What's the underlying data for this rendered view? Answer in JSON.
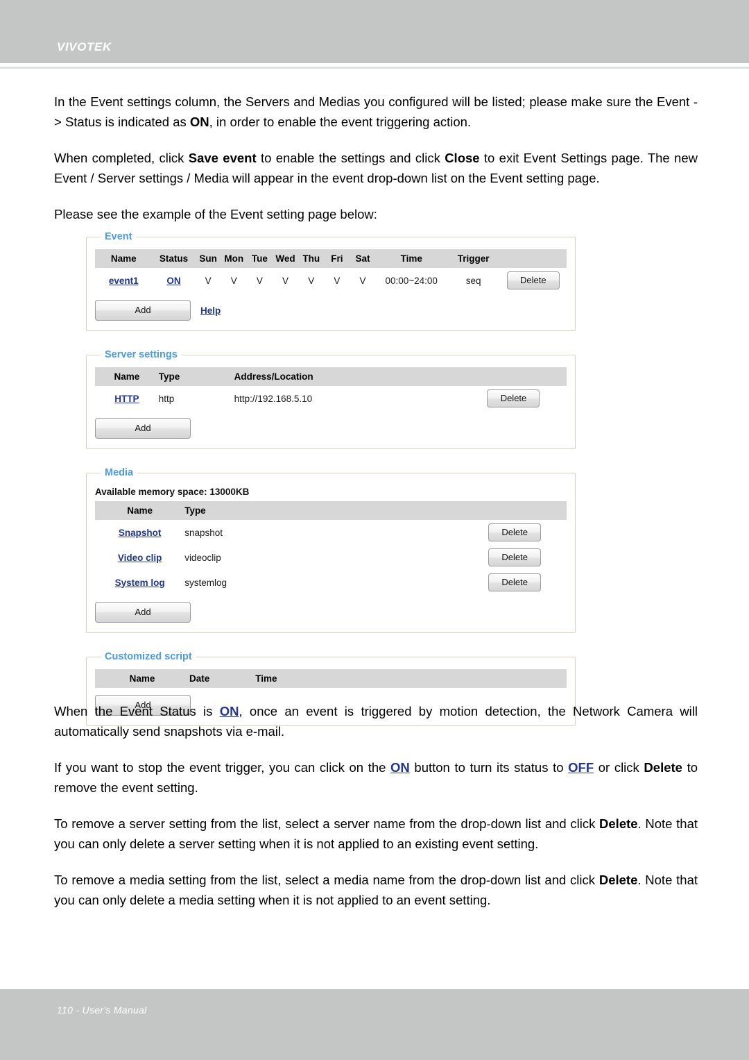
{
  "header": {
    "brand": "VIVOTEK"
  },
  "footer": {
    "text": "110 - User's Manual"
  },
  "intro": {
    "para1_a": "In the Event settings column, the Servers and Medias you configured will be listed; please make sure the Event -> Status is indicated as ",
    "para1_on": "ON",
    "para1_b": ", in order to enable the event triggering action.",
    "para2_a": "When completed, click ",
    "para2_save": "Save event",
    "para2_b": " to enable the settings and click ",
    "para2_close": "Close",
    "para2_c": " to exit Event Settings page. The new Event / Server settings / Media will appear in the event drop-down list on the Event setting page.",
    "para3": "Please see the example of the Event setting page below:"
  },
  "panels": {
    "event": {
      "legend": "Event",
      "columns": [
        "Name",
        "Status",
        "Sun",
        "Mon",
        "Tue",
        "Wed",
        "Thu",
        "Fri",
        "Sat",
        "Time",
        "Trigger",
        ""
      ],
      "rows": [
        {
          "name": "event1",
          "status": "ON",
          "sun": "V",
          "mon": "V",
          "tue": "V",
          "wed": "V",
          "thu": "V",
          "fri": "V",
          "sat": "V",
          "time": "00:00~24:00",
          "trigger": "seq",
          "delete_label": "Delete"
        }
      ],
      "add_label": "Add",
      "help_label": "Help"
    },
    "server_settings": {
      "legend": "Server settings",
      "columns": [
        "Name",
        "Type",
        "Address/Location",
        ""
      ],
      "rows": [
        {
          "name": "HTTP",
          "type": "http",
          "address": "http://192.168.5.10",
          "delete_label": "Delete"
        }
      ],
      "add_label": "Add"
    },
    "media": {
      "legend": "Media",
      "memory_note": "Available memory space: 13000KB",
      "columns": [
        "Name",
        "Type",
        "",
        ""
      ],
      "rows": [
        {
          "name": "Snapshot",
          "type": "snapshot",
          "delete_label": "Delete"
        },
        {
          "name": "Video clip",
          "type": "videoclip",
          "delete_label": "Delete"
        },
        {
          "name": "System log",
          "type": "systemlog",
          "delete_label": "Delete"
        }
      ],
      "add_label": "Add"
    },
    "customized_script": {
      "legend": "Customized script",
      "columns": [
        "Name",
        "Date",
        "Time"
      ],
      "rows": [],
      "add_label": "Add"
    }
  },
  "outro": {
    "para4_a": "When the Event Status is ",
    "para4_on": "ON",
    "para4_b": ", once an event is triggered by motion detection, the Network Camera will automatically send snapshots via e-mail.",
    "para5_a": "If you want to stop the event trigger, you can click on the ",
    "para5_on": "ON",
    "para5_b": " button to turn its status to ",
    "para5_off": "OFF",
    "para5_c": " or click ",
    "para5_delete": "Delete",
    "para5_d": " to remove the event setting.",
    "para6_a": "To remove a server setting from the list, select a server name from the drop-down list and click ",
    "para6_delete": "Delete",
    "para6_b": ". Note that you can only delete a server setting when it is not applied to an existing event setting.",
    "para7_a": "To remove a media setting from the list, select a media name from the drop-down list and click ",
    "para7_delete": "Delete",
    "para7_b": ". Note that you can only delete a media setting when it is not applied to an event setting."
  },
  "colors": {
    "band": "#c3c6c5",
    "legend_blue": "#4c9ae0",
    "link_blue": "#20368d",
    "table_header": "#d7d7d7",
    "panel_border": "#d8d3bd"
  }
}
